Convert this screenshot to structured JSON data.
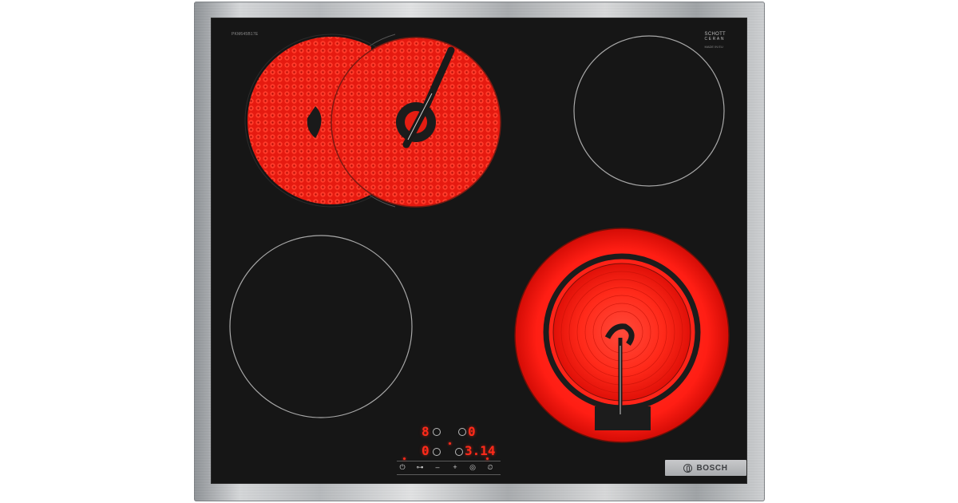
{
  "product": {
    "model_label": "PKM645B17E",
    "glass_brand_line1": "SCHOTT",
    "glass_brand_line2": "CERAN",
    "glass_brand_line3": "MADE IN EU",
    "brand": "BOSCH"
  },
  "display": {
    "top_left_digit": "8",
    "top_right_digit": "0",
    "bottom_left_digit": "0",
    "timer_value": "3.14"
  },
  "controls": {
    "keys": [
      {
        "label": "⏻",
        "icon": "power-icon"
      },
      {
        "label": "⊶",
        "icon": "lock-icon"
      },
      {
        "label": "–",
        "icon": "minus-icon"
      },
      {
        "label": "+",
        "icon": "plus-icon"
      },
      {
        "label": "◎",
        "icon": "zone-select-icon"
      },
      {
        "label": "⏲",
        "icon": "timer-icon"
      }
    ]
  },
  "zones": [
    {
      "name": "front-left",
      "state": "off"
    },
    {
      "name": "rear-left",
      "state": "on",
      "type": "dual-oval"
    },
    {
      "name": "rear-right",
      "state": "off"
    },
    {
      "name": "front-right",
      "state": "on",
      "type": "dual-ring"
    }
  ],
  "colors": {
    "glass": "#161616",
    "glow": "#ff2020",
    "display": "#ff2a1a",
    "frame": "#c2c4c6",
    "zone_outline": "#a8a8a8"
  }
}
